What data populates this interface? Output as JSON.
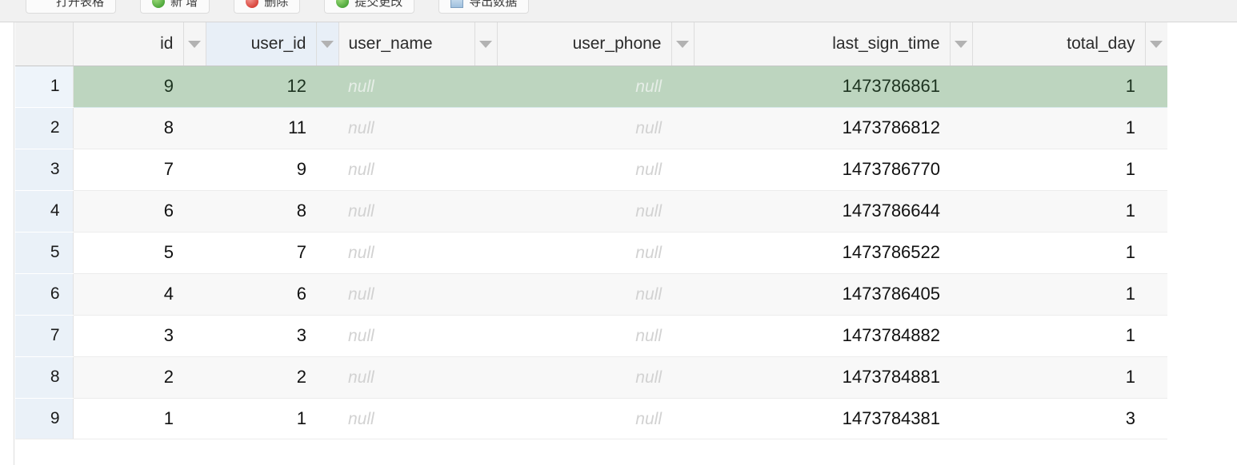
{
  "toolbar": {
    "buttons": [
      {
        "label": "打开表格",
        "icon": "blank-icon"
      },
      {
        "label": "新 增",
        "icon": "green-plus-icon"
      },
      {
        "label": "删除",
        "icon": "red-delete-icon"
      },
      {
        "label": "提交更改",
        "icon": "green-commit-icon"
      },
      {
        "label": "导出数据",
        "icon": "grid-export-icon"
      }
    ]
  },
  "grid": {
    "gutter_header": "",
    "filter_icon": "filter-funnel-icon",
    "columns": [
      {
        "key": "id",
        "label": "id",
        "align": "right",
        "active": false
      },
      {
        "key": "user_id",
        "label": "user_id",
        "align": "right",
        "active": true
      },
      {
        "key": "user_name",
        "label": "user_name",
        "align": "left",
        "active": false
      },
      {
        "key": "user_phone",
        "label": "user_phone",
        "align": "right",
        "active": false
      },
      {
        "key": "last_sign_time",
        "label": "last_sign_time",
        "align": "right",
        "active": false
      },
      {
        "key": "total_day",
        "label": "total_day",
        "align": "right",
        "active": false
      }
    ],
    "null_text": "null",
    "rows": [
      {
        "n": "1",
        "id": "9",
        "user_id": "12",
        "user_name": "null",
        "user_phone": "null",
        "last_sign_time": "1473786861",
        "total_day": "1",
        "selected": true
      },
      {
        "n": "2",
        "id": "8",
        "user_id": "11",
        "user_name": "null",
        "user_phone": "null",
        "last_sign_time": "1473786812",
        "total_day": "1",
        "selected": false
      },
      {
        "n": "3",
        "id": "7",
        "user_id": "9",
        "user_name": "null",
        "user_phone": "null",
        "last_sign_time": "1473786770",
        "total_day": "1",
        "selected": false
      },
      {
        "n": "4",
        "id": "6",
        "user_id": "8",
        "user_name": "null",
        "user_phone": "null",
        "last_sign_time": "1473786644",
        "total_day": "1",
        "selected": false
      },
      {
        "n": "5",
        "id": "5",
        "user_id": "7",
        "user_name": "null",
        "user_phone": "null",
        "last_sign_time": "1473786522",
        "total_day": "1",
        "selected": false
      },
      {
        "n": "6",
        "id": "4",
        "user_id": "6",
        "user_name": "null",
        "user_phone": "null",
        "last_sign_time": "1473786405",
        "total_day": "1",
        "selected": false
      },
      {
        "n": "7",
        "id": "3",
        "user_id": "3",
        "user_name": "null",
        "user_phone": "null",
        "last_sign_time": "1473784882",
        "total_day": "1",
        "selected": false
      },
      {
        "n": "8",
        "id": "2",
        "user_id": "2",
        "user_name": "null",
        "user_phone": "null",
        "last_sign_time": "1473784881",
        "total_day": "1",
        "selected": false
      },
      {
        "n": "9",
        "id": "1",
        "user_id": "1",
        "user_name": "null",
        "user_phone": "null",
        "last_sign_time": "1473784381",
        "total_day": "3",
        "selected": false
      }
    ]
  },
  "colors": {
    "selected_row": "#bdd5bf",
    "gutter": "#eaf1f8",
    "active_column_header": "#e8eff7",
    "header_bg": "#f5f5f5"
  }
}
